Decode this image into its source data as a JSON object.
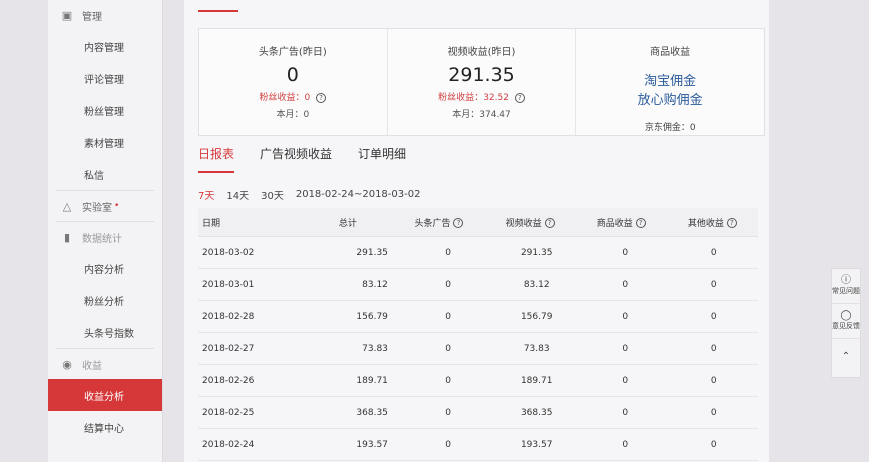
{
  "sidebar": {
    "manage_label": "管理",
    "manage_items": [
      "内容管理",
      "评论管理",
      "粉丝管理",
      "素材管理",
      "私信"
    ],
    "lab_label": "实验室",
    "lab_badge": "•",
    "stats_label": "数据统计",
    "stats_items": [
      "内容分析",
      "粉丝分析",
      "头条号指数"
    ],
    "revenue_label": "收益",
    "revenue_items": [
      "收益分析",
      "结算中心"
    ]
  },
  "summary": {
    "ad": {
      "title": "头条广告(昨日)",
      "value": "0",
      "fan_label": "粉丝收益：",
      "fan_value": "0",
      "month_label": "本月：",
      "month_value": "0"
    },
    "video": {
      "title": "视频收益(昨日)",
      "value": "291.35",
      "fan_label": "粉丝收益：",
      "fan_value": "32.52",
      "month_label": "本月：",
      "month_value": "374.47"
    },
    "goods": {
      "title": "商品收益",
      "link1": "淘宝佣金",
      "link2": "放心购佣金",
      "jd": "京东佣金：0"
    }
  },
  "tabs": [
    "日报表",
    "广告视频收益",
    "订单明细"
  ],
  "ranges": {
    "r7": "7天",
    "r14": "14天",
    "r30": "30天",
    "span": "2018-02-24~2018-03-02"
  },
  "table": {
    "headers": [
      "日期",
      "总计",
      "头条广告",
      "视频收益",
      "商品收益",
      "其他收益"
    ],
    "rows": [
      [
        "2018-03-02",
        "291.35",
        "0",
        "291.35",
        "0",
        "0"
      ],
      [
        "2018-03-01",
        "83.12",
        "0",
        "83.12",
        "0",
        "0"
      ],
      [
        "2018-02-28",
        "156.79",
        "0",
        "156.79",
        "0",
        "0"
      ],
      [
        "2018-02-27",
        "73.83",
        "0",
        "73.83",
        "0",
        "0"
      ],
      [
        "2018-02-26",
        "189.71",
        "0",
        "189.71",
        "0",
        "0"
      ],
      [
        "2018-02-25",
        "368.35",
        "0",
        "368.35",
        "0",
        "0"
      ],
      [
        "2018-02-24",
        "193.57",
        "0",
        "193.57",
        "0",
        "0"
      ]
    ]
  },
  "float": {
    "help": "常见问题",
    "feedback": "意见反馈"
  },
  "colors": {
    "accent": "#d6383a",
    "link": "#2a5a9a"
  }
}
